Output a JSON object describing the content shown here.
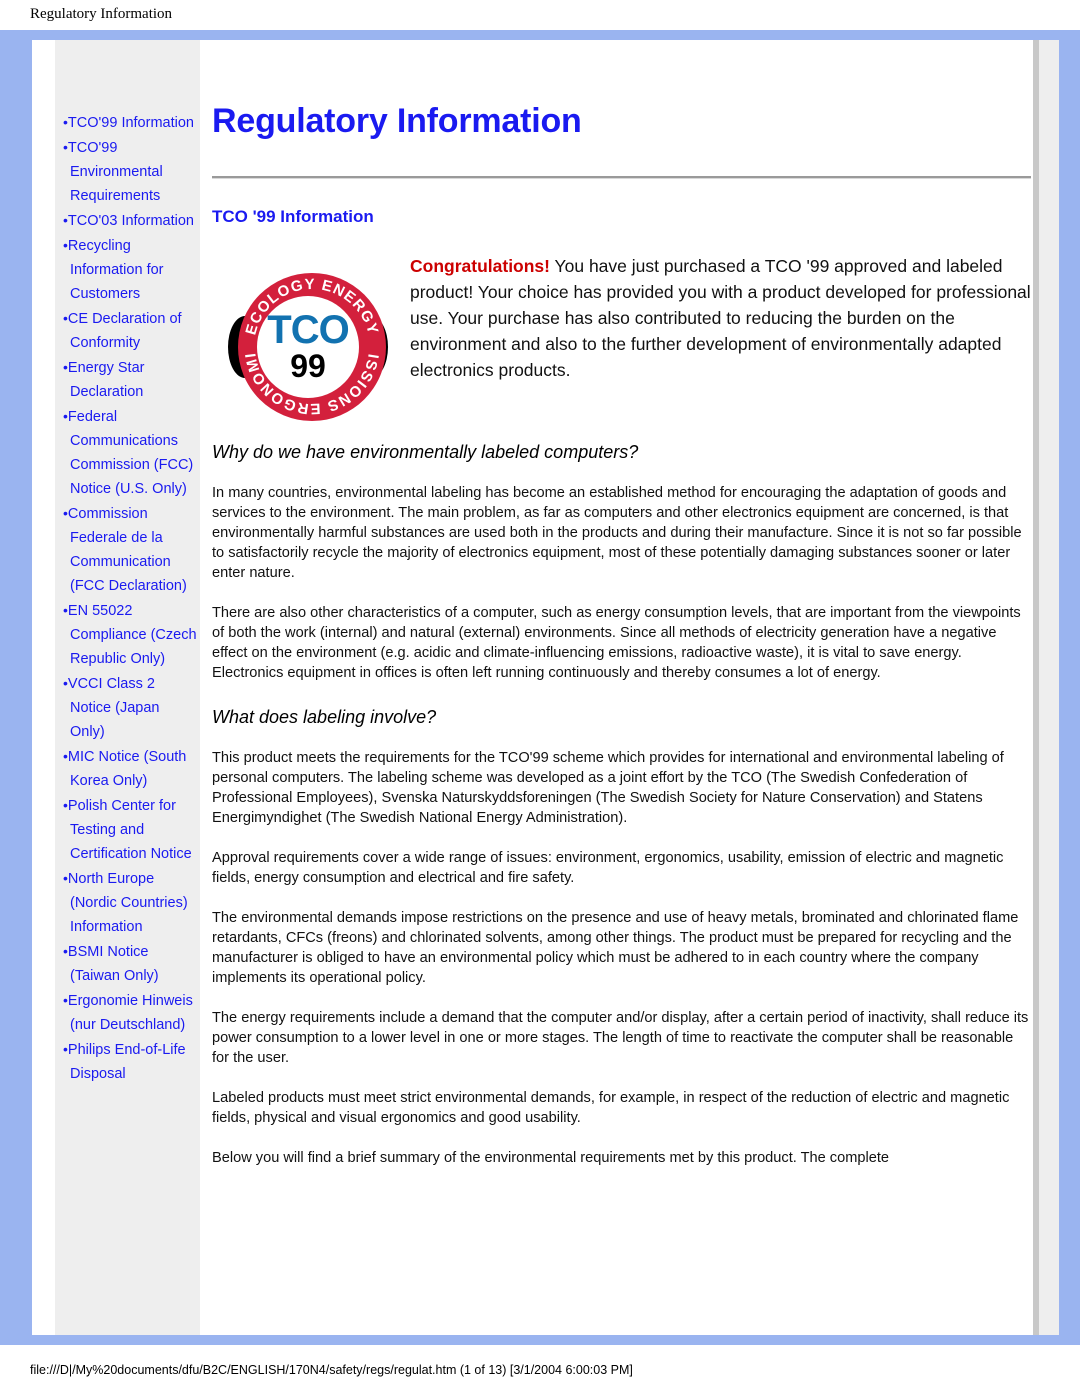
{
  "print_header": {
    "title": "Regulatory Information"
  },
  "print_footer": {
    "path": "file:///D|/My%20documents/dfu/B2C/ENGLISH/170N4/safety/regs/regulat.htm (1 of 13) [3/1/2004 6:00:03 PM]"
  },
  "colors": {
    "frame_blue": "#9ab4f0",
    "link_blue": "#1a1af0",
    "sidebar_bg": "#eeeeee",
    "congrats_red": "#cc0000",
    "logo_red": "#d3203c",
    "logo_blue": "#1272b0"
  },
  "sidebar": {
    "items": [
      {
        "label": "TCO'99 Information"
      },
      {
        "label": "TCO'99 Environmental Requirements"
      },
      {
        "label": "TCO'03 Information"
      },
      {
        "label": "Recycling Information for Customers"
      },
      {
        "label": "CE Declaration of Conformity"
      },
      {
        "label": "Energy Star Declaration"
      },
      {
        "label": "Federal Communications Commission (FCC) Notice (U.S. Only)"
      },
      {
        "label": "Commission Federale de la Communication (FCC Declaration)"
      },
      {
        "label": "EN 55022 Compliance (Czech Republic Only)"
      },
      {
        "label": "VCCI Class 2 Notice (Japan Only)"
      },
      {
        "label": "MIC Notice (South Korea Only)"
      },
      {
        "label": "Polish Center for Testing and Certification Notice"
      },
      {
        "label": "North Europe (Nordic Countries) Information"
      },
      {
        "label": "BSMI Notice (Taiwan Only)"
      },
      {
        "label": "Ergonomie Hinweis (nur Deutschland)"
      },
      {
        "label": "Philips End-of-Life Disposal"
      }
    ]
  },
  "main": {
    "page_title": "Regulatory Information",
    "section_title": "TCO '99 Information",
    "logo": {
      "top_text": "ECOLOGY ENERGY",
      "bottom_text": "EMISSIONS ERGONOMICS",
      "word": "TCO",
      "year": "99"
    },
    "intro": {
      "congrats": "Congratulations!",
      "text": " You have just purchased a TCO '99 approved and labeled product! Your choice has provided you with a product developed for professional use. Your purchase has also contributed to reducing the burden on the environment and also to the further development of environmentally adapted electronics products."
    },
    "headings": {
      "why": "Why do we have environmentally labeled computers?",
      "what": "What does labeling involve?"
    },
    "paragraphs": {
      "p1": "In many countries, environmental labeling has become an established method for encouraging the adaptation of goods and services to the environment. The main problem, as far as computers and other electronics equipment are concerned, is that environmentally harmful substances are used both in the products and during their manufacture. Since it is not so far possible to satisfactorily recycle the majority of electronics equipment, most of these potentially damaging substances sooner or later enter nature.",
      "p2": "There are also other characteristics of a computer, such as energy consumption levels, that are important from the viewpoints of both the work (internal) and natural (external) environments. Since all methods of electricity generation have a negative effect on the environment (e.g. acidic and climate-influencing emissions, radioactive waste), it is vital to save energy. Electronics equipment in offices is often left running continuously and thereby consumes a lot of energy.",
      "p3": "This product meets the requirements for the TCO'99 scheme which provides for international and environmental labeling of personal computers. The labeling scheme was developed as a joint effort by the TCO (The Swedish Confederation of Professional Employees), Svenska Naturskyddsforeningen (The Swedish Society for Nature Conservation) and Statens Energimyndighet (The Swedish National Energy Administration).",
      "p4": "Approval requirements cover a wide range of issues: environment, ergonomics, usability, emission of electric and magnetic fields, energy consumption and electrical and fire safety.",
      "p5": "The environmental demands impose restrictions on the presence and use of heavy metals, brominated and chlorinated flame retardants, CFCs (freons) and chlorinated solvents, among other things. The product must be prepared for recycling and the manufacturer is obliged to have an environmental policy which must be adhered to in each country where the company implements its operational policy.",
      "p6": "The energy requirements include a demand that the computer and/or display, after a certain period of inactivity, shall reduce its power consumption to a lower level in one or more stages. The length of time to reactivate the computer shall be reasonable for the user.",
      "p7": "Labeled products must meet strict environmental demands, for example, in respect of the reduction of electric and magnetic fields, physical and visual ergonomics and good usability.",
      "p8": "Below you will find a brief summary of the environmental requirements met by this product. The complete"
    }
  }
}
